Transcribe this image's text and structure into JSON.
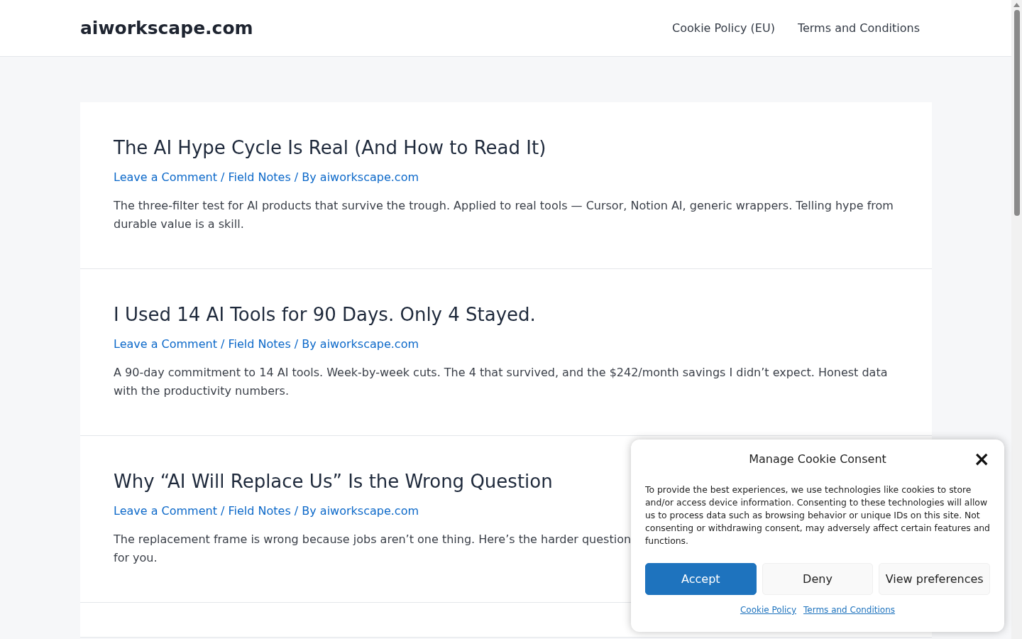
{
  "header": {
    "site_title": "aiworkscape.com",
    "nav": [
      {
        "label": "Cookie Policy (EU)"
      },
      {
        "label": "Terms and Conditions"
      }
    ]
  },
  "posts": [
    {
      "title": "The AI Hype Cycle Is Real (And How to Read It)",
      "meta": {
        "links": [
          "Leave a Comment",
          "Field Notes",
          "aiworkscape.com"
        ],
        "separators": [
          " / ",
          " / By "
        ]
      },
      "excerpt_lines": [
        "The three-filter test for AI products that survive the trough. Applied to real tools — Cursor, Notion AI, generic wrappers. Telling hype from",
        "durable value is a skill."
      ]
    },
    {
      "title": "I Used 14 AI Tools for 90 Days. Only 4 Stayed.",
      "meta": {
        "links": [
          "Leave a Comment",
          "Field Notes",
          "aiworkscape.com"
        ],
        "separators": [
          " / ",
          " / By "
        ]
      },
      "excerpt_lines": [
        "A 90-day commitment to 14 AI tools. Week-by-week cuts. The 4 that survived, and the $242/month savings I didn’t expect. Honest data",
        "with the productivity numbers."
      ]
    },
    {
      "title": "Why “AI Will Replace Us” Is the Wrong Question",
      "meta": {
        "links": [
          "Leave a Comment",
          "Field Notes",
          "aiworkscape.com"
        ],
        "separators": [
          " / ",
          " / By "
        ]
      },
      "excerpt_lines": [
        "The replacement frame is wrong because jobs aren’t one thing. Here’s the harder question",
        "for you."
      ]
    },
    {
      "kind": "empty"
    }
  ],
  "cookie_dialog": {
    "title": "Manage Cookie Consent",
    "close": "×",
    "message": "To provide the best experiences, we use technologies like cookies to store and/or access device information. Consenting to these technologies will allow us to process data such as browsing behavior or unique IDs on this site. Not consenting or withdrawing consent, may adversely affect certain features and functions.",
    "buttons": [
      {
        "label": "Accept",
        "kind": "primary"
      },
      {
        "label": "Deny",
        "kind": "secondary"
      },
      {
        "label": "View preferences",
        "kind": "secondary"
      }
    ],
    "links": [
      {
        "label": "Cookie Policy"
      },
      {
        "label": "Terms and Conditions"
      }
    ]
  }
}
